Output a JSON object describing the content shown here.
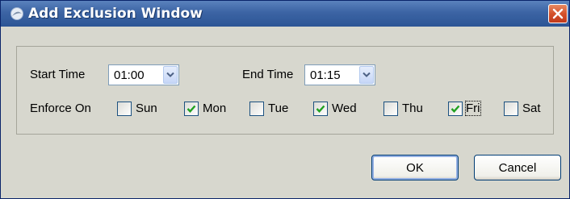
{
  "window": {
    "title": "Add Exclusion Window"
  },
  "start_time": {
    "label": "Start Time",
    "value": "01:00"
  },
  "end_time": {
    "label": "End Time",
    "value": "01:15"
  },
  "enforce_on": {
    "label": "Enforce On",
    "days": [
      {
        "label": "Sun",
        "checked": false
      },
      {
        "label": "Mon",
        "checked": true
      },
      {
        "label": "Tue",
        "checked": false
      },
      {
        "label": "Wed",
        "checked": true
      },
      {
        "label": "Thu",
        "checked": false
      },
      {
        "label": "Fri",
        "checked": true
      },
      {
        "label": "Sat",
        "checked": false
      }
    ]
  },
  "buttons": {
    "ok": "OK",
    "cancel": "Cancel"
  },
  "colors": {
    "titlebar": "#3c64a4",
    "dialog_bg": "#d7d7ce",
    "close_button": "#d4522b",
    "checkmark": "#21a121"
  }
}
